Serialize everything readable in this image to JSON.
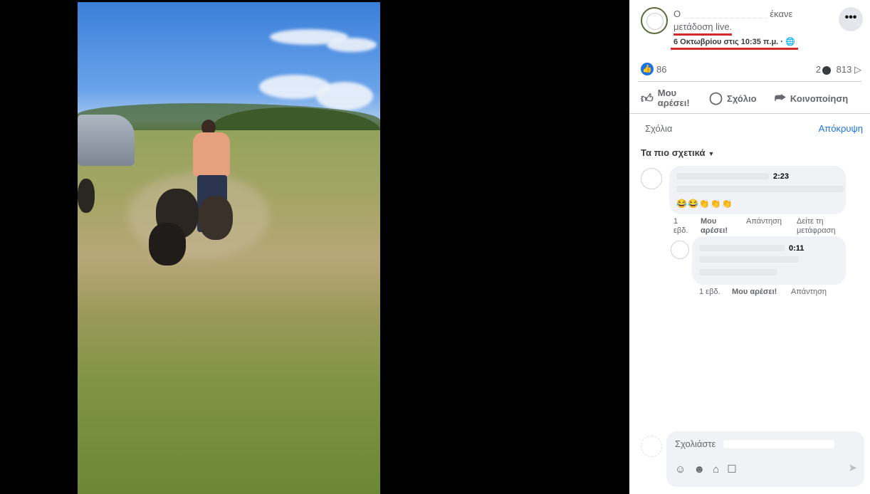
{
  "post": {
    "author_prefix": "Ο",
    "action_suffix": "έκανε",
    "action_live": "μετάδοση live.",
    "date": "6 Οκτωβρίου στις 10:35 π.μ. · ",
    "more_icon": "more-horizontal-icon",
    "more_label": "•••"
  },
  "stats": {
    "likes": "86",
    "comments": "2",
    "views": "813"
  },
  "actions": {
    "like_line1": "Μου",
    "like_line2": "αρέσει!",
    "comment": "Σχόλιο",
    "share": "Κοινοποίηση"
  },
  "comments_section": {
    "header": "Σχόλια",
    "hide": "Απόκρυψη",
    "sort": "Τα πιο σχετικά"
  },
  "comments": [
    {
      "time": "2:23",
      "emoji": "😂😂👏👏👏",
      "age_line1": "1",
      "age_line2": "εβδ.",
      "like_line1": "Μου",
      "like_line2": "αρέσει!",
      "reply": "Απάντηση",
      "translate_line1": "Δείτε τη",
      "translate_line2": "μετάφραση"
    },
    {
      "time": "0:11",
      "age": "1 εβδ.",
      "like": "Μου αρέσει!",
      "reply": "Απάντηση"
    }
  ],
  "composer": {
    "placeholder": "Σχολιάστε",
    "tools": [
      "emoji-icon",
      "smiley-icon",
      "camera-icon",
      "sticker-icon"
    ],
    "send_icon": "send-icon"
  },
  "colors": {
    "accent": "#1b74e4",
    "highlight": "#d12b2b"
  }
}
